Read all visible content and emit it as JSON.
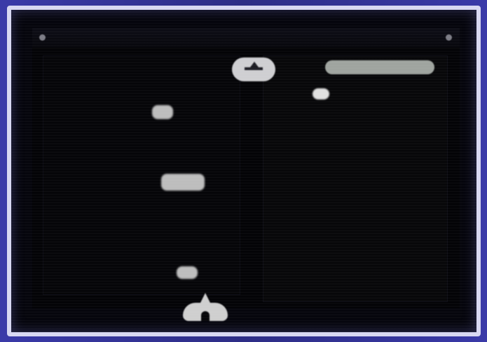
{
  "window": {
    "title": ""
  },
  "header": {
    "button_label": ""
  },
  "icons": {
    "menu": "menu-icon",
    "badge": "profile-badge-icon",
    "ship": "ship-icon"
  },
  "colors": {
    "frame": "#2d2d86",
    "bezel": "#d8d8f2",
    "screen": "#030306",
    "badge": "#cfcfd2",
    "pill": "#9fa49f"
  }
}
